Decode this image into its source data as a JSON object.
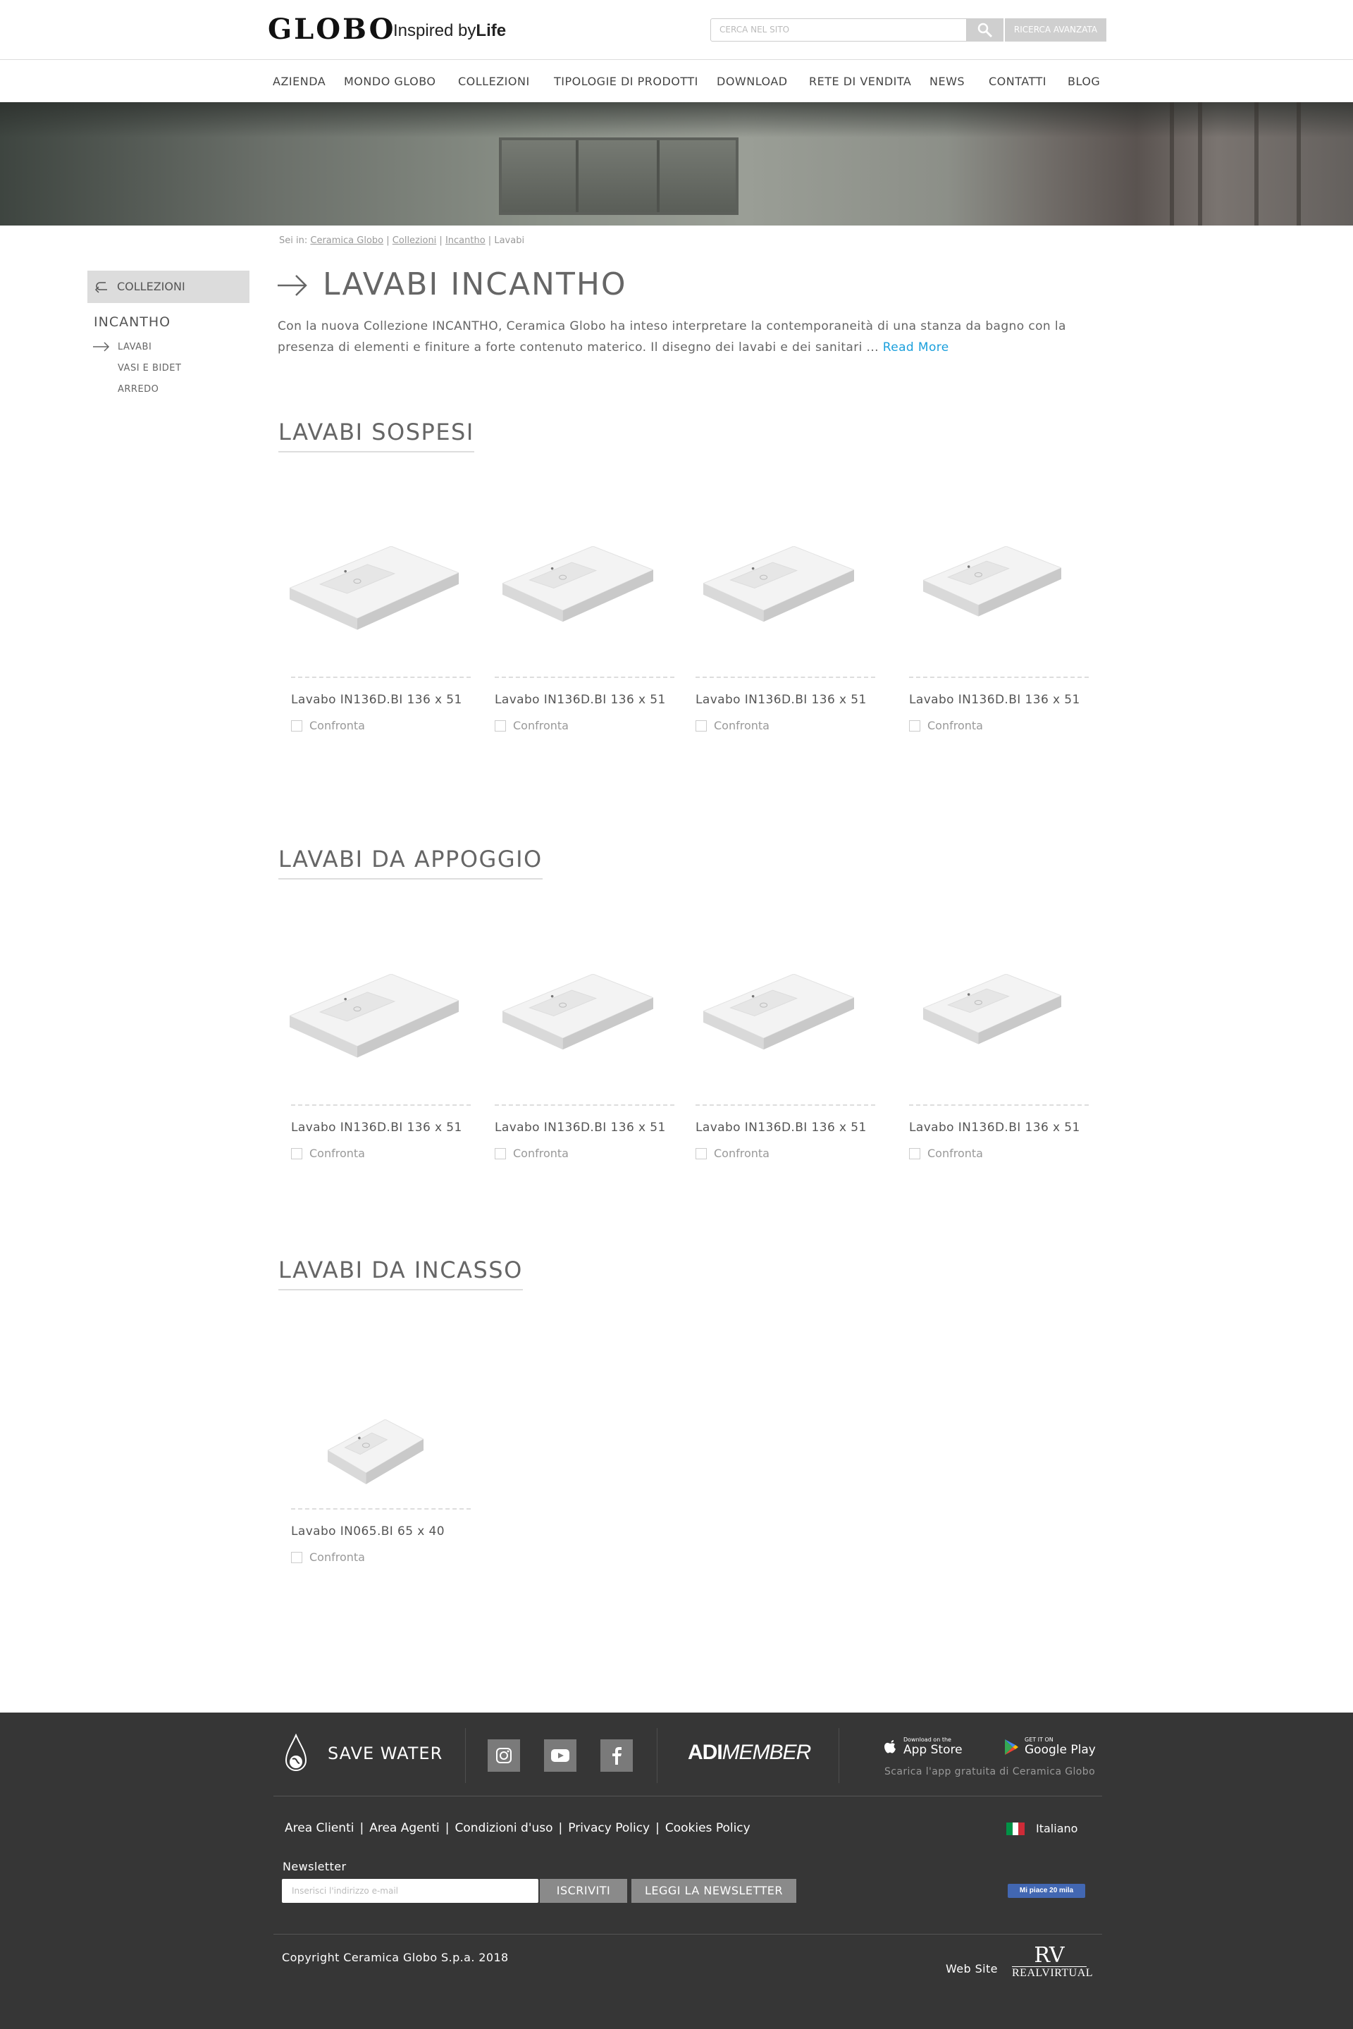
{
  "header": {
    "logo": "GLOBO",
    "tagline_prefix": "Inspired by",
    "tagline_bold": "Life",
    "search_placeholder": "CERCA NEL SITO",
    "advanced_search": "RICERCA AVANZATA"
  },
  "nav": [
    "AZIENDA",
    "MONDO GLOBO",
    "COLLEZIONI",
    "TIPOLOGIE DI PRODOTTI",
    "DOWNLOAD",
    "RETE DI VENDITA",
    "NEWS",
    "CONTATTI",
    "BLOG"
  ],
  "breadcrumb": {
    "prefix": "Sei in:",
    "links": [
      "Ceramica Globo",
      "Collezioni",
      "Incantho"
    ],
    "current": "Lavabi"
  },
  "sidebar": {
    "back_label": "COLLEZIONI",
    "title": "INCANTHO",
    "items": [
      "LAVABI",
      "VASI E BIDET",
      "ARREDO"
    ]
  },
  "page": {
    "title": "LAVABI INCANTHO",
    "intro": "Con la nuova Collezione INCANTHO, Ceramica Globo ha inteso interpretare la contemporaneità di una stanza da bagno con la presenza di elementi e finiture a forte contenuto materico. Il disegno dei lavabi e dei sanitari ...",
    "read_more": "Read More"
  },
  "sections": [
    {
      "title": "LAVABI SOSPESI",
      "products": [
        {
          "name": "Lavabo IN136D.BI 136 x 51",
          "compare": "Confronta"
        },
        {
          "name": "Lavabo IN136D.BI 136 x 51",
          "compare": "Confronta"
        },
        {
          "name": "Lavabo IN136D.BI 136 x 51",
          "compare": "Confronta"
        },
        {
          "name": "Lavabo IN136D.BI 136 x 51",
          "compare": "Confronta"
        }
      ]
    },
    {
      "title": "LAVABI DA APPOGGIO",
      "products": [
        {
          "name": "Lavabo IN136D.BI 136 x 51",
          "compare": "Confronta"
        },
        {
          "name": "Lavabo IN136D.BI 136 x 51",
          "compare": "Confronta"
        },
        {
          "name": "Lavabo IN136D.BI 136 x 51",
          "compare": "Confronta"
        },
        {
          "name": "Lavabo IN136D.BI 136 x 51",
          "compare": "Confronta"
        }
      ]
    },
    {
      "title": "LAVABI DA INCASSO",
      "products": [
        {
          "name": "Lavabo IN065.BI 65 x 40",
          "compare": "Confronta"
        }
      ]
    }
  ],
  "footer": {
    "save_water": "SAVE WATER",
    "social_icons": [
      "instagram-icon",
      "youtube-icon",
      "facebook-icon"
    ],
    "adi_bold": "ADI",
    "adi_italic": "MEMBER",
    "app_store_small": "Download on the",
    "app_store_big": "App Store",
    "google_play_small": "GET IT ON",
    "google_play_big": "Google Play",
    "app_note": "Scarica l'app gratuita di Ceramica Globo",
    "links": [
      "Area Clienti",
      "Area Agenti",
      "Condizioni d'uso",
      "Privacy Policy",
      "Cookies Policy"
    ],
    "language": "Italiano",
    "newsletter_label": "Newsletter",
    "newsletter_placeholder": "Inserisci l'indirizzo e-mail",
    "subscribe": "ISCRIVITI",
    "read_newsletter": "LEGGI LA NEWSLETTER",
    "fb_like": "Mi piace 20 mila",
    "copyright": "Copyright Ceramica Globo S.p.a. 2018",
    "website_label": "Web Site",
    "rv_mono": "RV",
    "rv_word": "REALVIRTUAL"
  },
  "colors": {
    "read_more": "#1a9fdc",
    "footer_bg": "#363636",
    "sidebar_head_bg": "#dcdcdc"
  }
}
